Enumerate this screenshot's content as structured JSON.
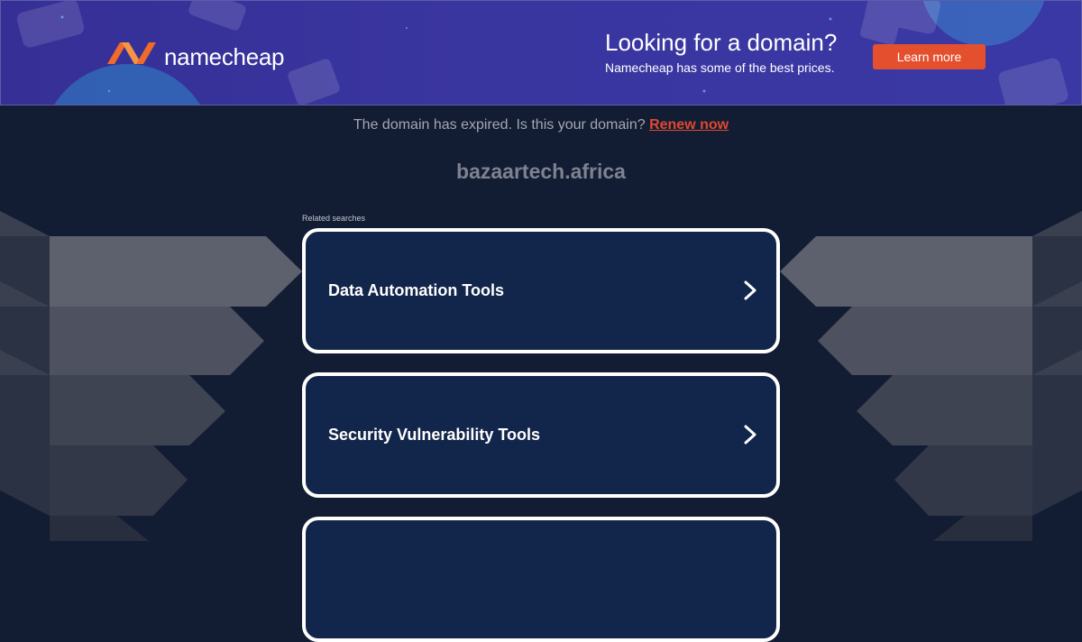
{
  "banner": {
    "brand": "namecheap",
    "headline": "Looking for a domain?",
    "subline": "Namecheap has some of the best prices.",
    "cta_label": "Learn more",
    "colors": {
      "background": "#3a36a0",
      "cta": "#e4502e",
      "logo_orange": "#f06a2a"
    }
  },
  "notice": {
    "text": "The domain has expired. Is this your domain? ",
    "link_label": "Renew now"
  },
  "domain": "bazaartech.africa",
  "related": {
    "label": "Related searches",
    "items": [
      {
        "label": "Data Automation Tools",
        "icon": "chevron-right-icon"
      },
      {
        "label": "Security Vulnerability Tools",
        "icon": "chevron-right-icon"
      },
      {
        "label": "",
        "icon": "chevron-right-icon"
      }
    ]
  },
  "colors": {
    "page_bg": "#121c33",
    "card_bg": "#12254a",
    "renew_link": "#e0492f"
  }
}
